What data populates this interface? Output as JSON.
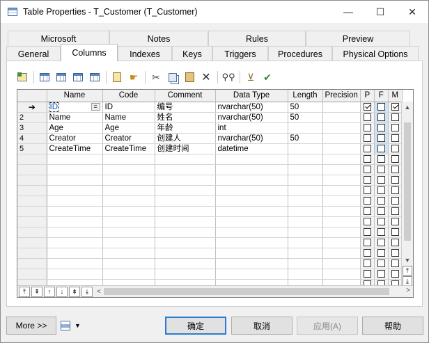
{
  "window": {
    "title": "Table Properties - T_Customer (T_Customer)",
    "minimize_glyph": "—",
    "maximize_glyph": "☐",
    "close_glyph": "✕"
  },
  "tabs": {
    "back_row": [
      "Microsoft",
      "Notes",
      "Rules",
      "Preview"
    ],
    "front_row": [
      "General",
      "Columns",
      "Indexes",
      "Keys",
      "Triggers",
      "Procedures",
      "Physical Options"
    ],
    "active": "Columns"
  },
  "toolbar": {
    "icons": [
      "properties-icon",
      "insert-row-icon",
      "add-row-icon",
      "add-columns-icon",
      "replace-columns-icon",
      "new-document-icon",
      "customize-icon",
      "cut-icon",
      "copy-icon",
      "paste-icon",
      "delete-icon",
      "find-icon",
      "filter-icon",
      "check-model-icon"
    ]
  },
  "grid": {
    "headers": [
      "Name",
      "Code",
      "Comment",
      "Data Type",
      "Length",
      "Precision",
      "P",
      "F",
      "M"
    ],
    "current_row_glyph": "➔",
    "equals_button": "=",
    "rows": [
      {
        "num": "",
        "name": "ID",
        "code": "ID",
        "comment": "编号",
        "data_type": "nvarchar(50)",
        "length": "50",
        "precision": "",
        "p": true,
        "f": false,
        "m": true
      },
      {
        "num": "2",
        "name": "Name",
        "code": "Name",
        "comment": "姓名",
        "data_type": "nvarchar(50)",
        "length": "50",
        "precision": "",
        "p": false,
        "f": false,
        "m": false
      },
      {
        "num": "3",
        "name": "Age",
        "code": "Age",
        "comment": "年龄",
        "data_type": "int",
        "length": "",
        "precision": "",
        "p": false,
        "f": false,
        "m": false
      },
      {
        "num": "4",
        "name": "Creator",
        "code": "Creator",
        "comment": "创建人",
        "data_type": "nvarchar(50)",
        "length": "50",
        "precision": "",
        "p": false,
        "f": false,
        "m": false
      },
      {
        "num": "5",
        "name": "CreateTime",
        "code": "CreateTime",
        "comment": "创建时间",
        "data_type": "datetime",
        "length": "",
        "precision": "",
        "p": false,
        "f": false,
        "m": false
      }
    ],
    "empty_rows": 13,
    "nav_glyphs": [
      "⤒",
      "⇞",
      "↑",
      "↓",
      "⇟",
      "⤓"
    ],
    "scroll_left": "<",
    "scroll_right": ">"
  },
  "footer": {
    "more": "More >>",
    "ok": "确定",
    "cancel": "取消",
    "apply": "应用(A)",
    "help": "帮助"
  },
  "colors": {
    "accent": "#2a7bd4",
    "flag_blue": "#cfe3f5"
  }
}
